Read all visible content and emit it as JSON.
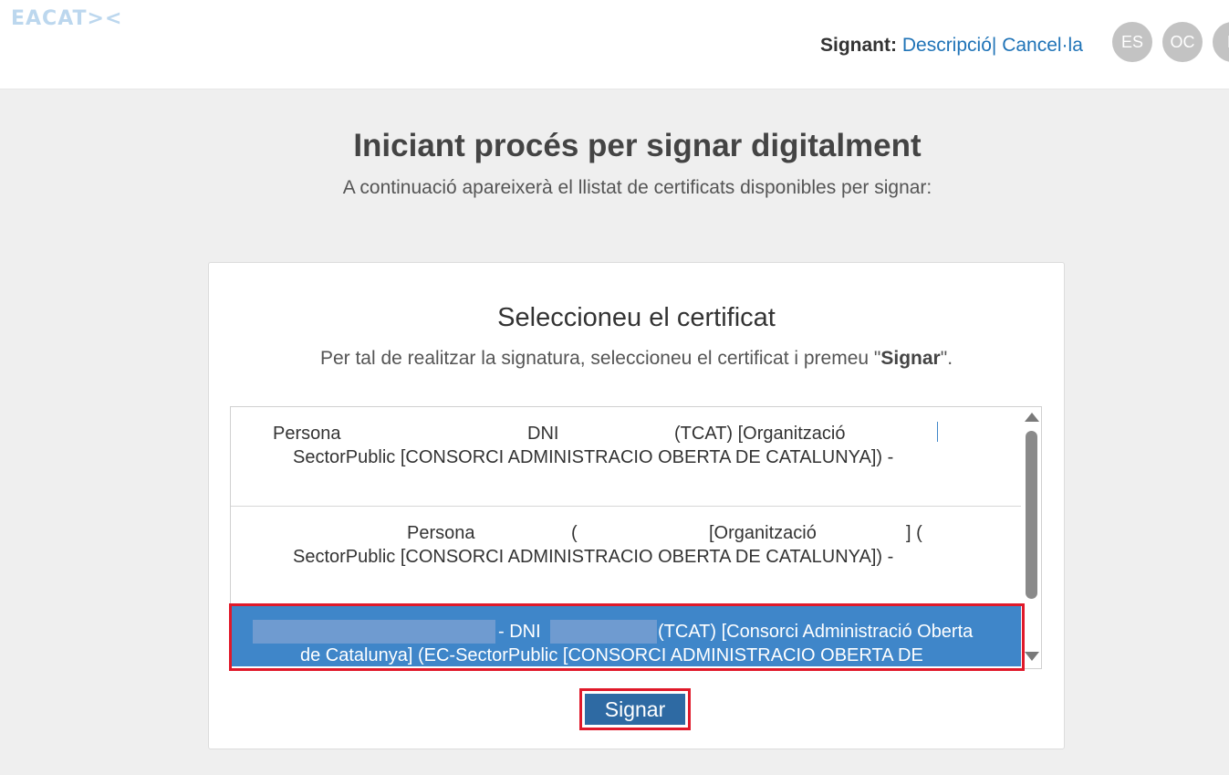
{
  "header": {
    "logo": "EACAT><",
    "signer_label": "Signant:",
    "description_link": "Descripció",
    "separator": "|",
    "cancel_link": "Cancel·la",
    "languages": [
      "ES",
      "OC",
      "E"
    ]
  },
  "main": {
    "title": "Iniciant procés per signar digitalment",
    "subtitle": "A continuació apareixerà el llistat de certificats disponibles per signar:"
  },
  "panel": {
    "title": "Seleccioneu el certificat",
    "instruction_prefix": "Per tal de realitzar la signatura, seleccioneu el certificat i premeu \"",
    "instruction_bold": "Signar",
    "instruction_suffix": "\"."
  },
  "certificates": [
    {
      "line1_a": "Persona",
      "line1_b": "DNI",
      "line1_c": "(TCAT) [Organització",
      "line2": "SectorPublic [CONSORCI ADMINISTRACIO OBERTA DE CATALUNYA]) -",
      "selected": false
    },
    {
      "line1_a": "Persona",
      "line1_b": "(",
      "line1_c": "[Organització",
      "line1_d": "] (",
      "line2": "SectorPublic [CONSORCI ADMINISTRACIO OBERTA DE CATALUNYA]) -",
      "selected": false
    },
    {
      "line1_a": "- DNI",
      "line1_b": "(TCAT) [Consorci Administració Oberta",
      "line2": "de Catalunya] (EC-SectorPublic [CONSORCI ADMINISTRACIO OBERTA DE",
      "selected": true
    }
  ],
  "actions": {
    "sign_label": "Signar"
  },
  "colors": {
    "accent_link": "#1f73b7",
    "selected_row": "#3f86c9",
    "sign_button": "#2e6aa3",
    "highlight_outline": "#e0192a"
  }
}
